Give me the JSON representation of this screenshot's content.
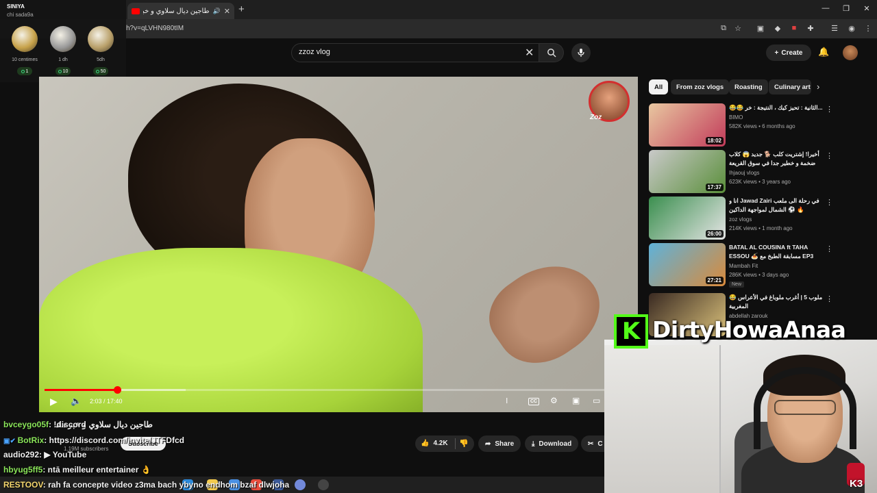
{
  "browser": {
    "tab_title": "طاجين ديال سلاوي و خبر مفـ",
    "url": "h?v=qLVHN980tIM",
    "new_tab_icon": "plus-icon",
    "window_buttons": [
      "—",
      "❐",
      "✕"
    ]
  },
  "youtube": {
    "search_value": "zzoz vlog",
    "create_label": "Create"
  },
  "coins": {
    "user": "SINIYA",
    "subtitle": "chi sada9a",
    "items": [
      {
        "label": "10 centimes",
        "count": "1",
        "color": "#c7a24a"
      },
      {
        "label": "1 dh",
        "count": "10",
        "color": "#9a9a9a"
      },
      {
        "label": "5dh",
        "count": "50",
        "color": "#b9a06a"
      }
    ]
  },
  "player": {
    "time": "2:03 / 17:40",
    "progress_fraction": 0.124,
    "buffered_fraction": 0.24,
    "watermark": "Zoz"
  },
  "video": {
    "title_partial": "طاجين ديال سلاوي و خبر مفـ",
    "subscriber_count": "1.19M subscribers",
    "subscribe_label": "Subscribe",
    "like_count": "4.2K",
    "share_label": "Share",
    "download_label": "Download",
    "clip_label": "C"
  },
  "chips": [
    "All",
    "From zoz vlogs",
    "Roasting",
    "Culinary art"
  ],
  "recommendations": [
    {
      "title": "😂😂 الثانية : تحيز كيك ، النتيجة : خر...",
      "channel": "BIMO",
      "meta": "582K views • 6 months ago",
      "duration": "18:02",
      "colors": [
        "#e8c7a0",
        "#c23b5a"
      ]
    },
    {
      "title": "أخيرا! إشتريت كلب 🐕 جديد 😱 كلاب ضخمة و خطير جدا في سوق القريعة يوم ...",
      "channel": "Ihjaouj vlogs",
      "meta": "623K views • 3 years ago",
      "duration": "17:37",
      "colors": [
        "#c9c9c9",
        "#5a8f3a"
      ]
    },
    {
      "title": "انا و Jawad Zairi في رحلة الى ملعب ⚽ الشمال لمواجهة الداكين 🔥",
      "channel": "zoz vlogs",
      "meta": "214K views • 1 month ago",
      "duration": "26:00",
      "colors": [
        "#3b8f4f",
        "#e5e5e5"
      ]
    },
    {
      "title": "BATAL AL COUSINA ft TAHA ESSOU 🍝 مسابقة الطبخ مع EP3",
      "channel": "Mambah Fit",
      "meta": "286K views • 3 days ago",
      "duration": "27:21",
      "badge": "New",
      "colors": [
        "#5fb2d9",
        "#d98a3b"
      ]
    },
    {
      "title": "😂 ملوب 5 | أغرب ملوباغ في الأعراس المغربية",
      "channel": "abdellah zarouk",
      "meta": "",
      "duration": "",
      "colors": [
        "#3a2a22",
        "#d9c07a"
      ]
    }
  ],
  "kick": {
    "logo_letter": "K",
    "streamer": "DirtyHowaAnaa",
    "brand_color": "#53fc18"
  },
  "chat": [
    {
      "user": "bvceygo05f",
      "message": ": !discord"
    },
    {
      "user": "BotRix",
      "message": ": https://discord.com/invite/JTFDfcd"
    },
    {
      "user": "audio292",
      "message": ": ▶ YouTube"
    },
    {
      "user": "hbyug5ff5",
      "message": ": ntā meilleur entertainer 👌"
    },
    {
      "user": "RESTOOV",
      "message": ": rah fa concepte video z3ma bach ybyno endhom bzaf dlwjoha"
    }
  ],
  "corner_label": "K3"
}
